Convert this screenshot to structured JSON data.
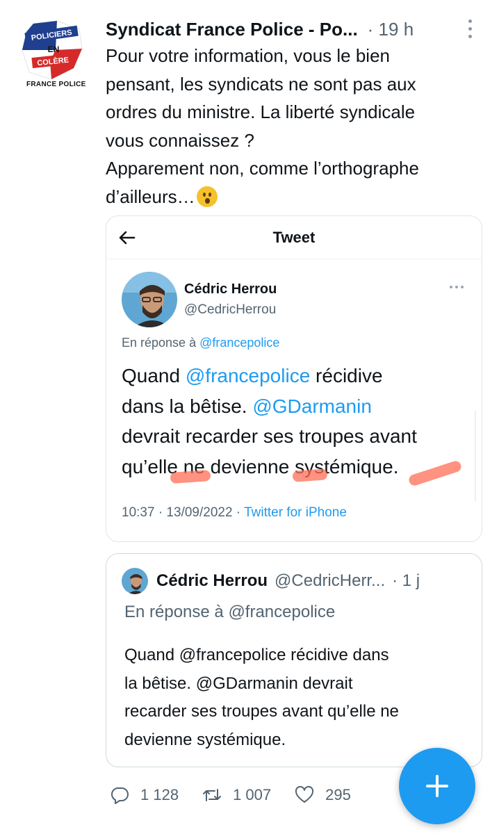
{
  "tweet": {
    "author_name": "Syndicat France Police - Po...",
    "timestamp": "· 19 h",
    "logo_text": {
      "line1": "POLICIERS",
      "line2": "EN",
      "line3": "COLÈRE",
      "caption": "FRANCE POLICE"
    },
    "text_lines": [
      "Pour votre information, vous le bien",
      "pensant, les syndicats ne sont pas aux",
      "ordres du ministre. La liberté syndicale",
      "vous connaissez ?",
      "Apparement non, comme l’orthographe",
      "d’ailleurs…"
    ],
    "emoji_icon": "hushed-face-emoji"
  },
  "embedded_screenshot": {
    "header_title": "Tweet",
    "back_icon": "arrow-left-icon",
    "author_name": "Cédric Herrou",
    "author_handle": "@CedricHerrou",
    "reply_prefix": "En réponse à",
    "reply_mention": "@francepolice",
    "text": {
      "line1_pre": "Quand ",
      "line1_mention": "@francepolice",
      "line1_post": " récidive",
      "line2_pre": "dans la bêtise. ",
      "line2_mention": "@GDarmanin",
      "line3": "devrait recarder ses troupes avant",
      "line4": "qu’elle ne devienne systémique."
    },
    "time": "10:37 · 13/09/2022 · ",
    "source": "Twitter for iPhone"
  },
  "quoted_tweet": {
    "author_name": "Cédric Herrou",
    "author_handle": "@CedricHerr...",
    "timestamp": "· 1 j",
    "reply_line": "En réponse à @francepolice",
    "text_lines": [
      "Quand @francepolice récidive dans",
      "la bêtise. @GDarmanin devrait",
      "recarder ses troupes avant qu’elle ne",
      "devienne systémique."
    ]
  },
  "actions": {
    "replies": "1 128",
    "retweets": "1 007",
    "likes": "295"
  },
  "colors": {
    "accent": "#1d9bf0",
    "text": "#0f1419",
    "secondary": "#536471",
    "highlight": "#ff6e55"
  }
}
